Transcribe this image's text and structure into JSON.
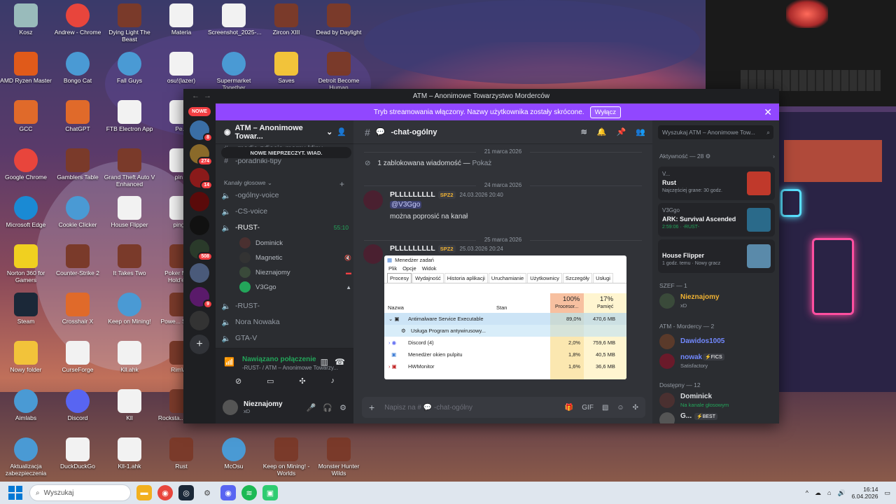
{
  "colors": {
    "accent": "#5865f2",
    "stream": "#9147ff",
    "online": "#23a55a",
    "danger": "#f23f43"
  },
  "desktop": {
    "icons": [
      {
        "label": "Kosz",
        "icon": "recycle-bin-icon"
      },
      {
        "label": "Andrew - Chrome",
        "icon": "chrome-icon"
      },
      {
        "label": "Dying Light The Beast",
        "icon": "game-icon"
      },
      {
        "label": "Materia",
        "icon": "file-icon"
      },
      {
        "label": "Screenshot_2025-...",
        "icon": "file-icon"
      },
      {
        "label": "Zircon XIII",
        "icon": "game-icon"
      },
      {
        "label": "Dead by Daylight",
        "icon": "game-icon"
      },
      {
        "label": "AMD Ryzen Master",
        "icon": "amd-icon"
      },
      {
        "label": "Bongo Cat",
        "icon": "web-icon"
      },
      {
        "label": "Fall Guys",
        "icon": "web-icon"
      },
      {
        "label": "osu!(lazer)",
        "icon": "file-icon"
      },
      {
        "label": "Supermarket Together",
        "icon": "web-icon"
      },
      {
        "label": "Saves",
        "icon": "folder-icon"
      },
      {
        "label": "Detroit Become Human",
        "icon": "game-icon"
      },
      {
        "label": "GCC",
        "icon": "app-icon"
      },
      {
        "label": "ChatGPT",
        "icon": "app-icon"
      },
      {
        "label": "FTB Electron App",
        "icon": "file-icon"
      },
      {
        "label": "Pe...",
        "icon": "file-icon"
      },
      {
        "label": "Google Chrome",
        "icon": "chrome-icon"
      },
      {
        "label": "Gamblers Table",
        "icon": "game-icon"
      },
      {
        "label": "Grand Theft Auto V Enhanced",
        "icon": "game-icon"
      },
      {
        "label": "pin...",
        "icon": "file-icon"
      },
      {
        "label": "Microsoft Edge",
        "icon": "edge-icon"
      },
      {
        "label": "Cookie Clicker",
        "icon": "web-icon"
      },
      {
        "label": "House Flipper",
        "icon": "file-icon"
      },
      {
        "label": "ping...",
        "icon": "file-icon"
      },
      {
        "label": "Norton 360 for Gamers",
        "icon": "norton-icon"
      },
      {
        "label": "Counter-Strike 2",
        "icon": "game-icon"
      },
      {
        "label": "It Takes Two",
        "icon": "game-icon"
      },
      {
        "label": "Poker Mas... Hold'em...",
        "icon": "game-icon"
      },
      {
        "label": "Steam",
        "icon": "steam-icon"
      },
      {
        "label": "Crosshair X",
        "icon": "app-icon"
      },
      {
        "label": "Keep on Mining!",
        "icon": "web-icon"
      },
      {
        "label": "Powe... Simul...",
        "icon": "game-icon"
      },
      {
        "label": "Nowy folder",
        "icon": "folder-icon"
      },
      {
        "label": "CurseForge",
        "icon": "file-icon"
      },
      {
        "label": "Kll.ahk",
        "icon": "file-icon"
      },
      {
        "label": "RimW...",
        "icon": "game-icon"
      },
      {
        "label": "Aimlabs",
        "icon": "web-icon"
      },
      {
        "label": "Discord",
        "icon": "discord-icon"
      },
      {
        "label": "Kll",
        "icon": "file-icon"
      },
      {
        "label": "Rocksta... Laun...",
        "icon": "game-icon"
      },
      {
        "label": "Aktualizacja zabezpieczenia",
        "icon": "web-icon"
      },
      {
        "label": "DuckDuckGo",
        "icon": "file-icon"
      },
      {
        "label": "Kll-1.ahk",
        "icon": "file-icon"
      },
      {
        "label": "Rust",
        "icon": "game-icon"
      },
      {
        "label": "McOsu",
        "icon": "web-icon"
      },
      {
        "label": "Keep on Mining! - Worlds",
        "icon": "game-icon"
      },
      {
        "label": "Monster Hunter Wilds",
        "icon": "game-icon"
      }
    ]
  },
  "taskbar": {
    "search_placeholder": "Wyszukaj",
    "time": "16:14",
    "date": "6.04.2026"
  },
  "discord": {
    "window_title": "ATM – Anonimowe Towarzystwo Morderców",
    "banner": {
      "text": "Tryb streamowania włączony. Nazwy użytkownika zostały skrócone.",
      "button": "Wyłącz"
    },
    "rail": {
      "nowe": "NOWE",
      "badges": [
        "8",
        "274",
        "14",
        "",
        "508",
        "9"
      ]
    },
    "server_name": "ATM – Anonimowe Towar...",
    "unread_pill": "NOWE NIEPRZECZYT. WIAD.",
    "channels": [
      {
        "name": "-media-zdjecia-memy-klipy"
      },
      {
        "name": "-poradniki-tipy"
      }
    ],
    "voice_category": "Kanały głosowe",
    "voice_channels": {
      "ogolny": "-ogólny-voice",
      "cs": "-CS-voice",
      "rust": "-RUST-",
      "rust_time": "55:10",
      "rust2": "-RUST-",
      "nora": "Nora Nowaka",
      "gta": "GTA-V"
    },
    "voice_users": [
      "Dominick",
      "Magnetic",
      "Nieznajomy",
      "V3Ggo"
    ],
    "connection": {
      "status": "Nawiązano połączenie",
      "detail": "-RUST- / ATM – Anonimowe Towarzy..."
    },
    "me": {
      "name": "Nieznajomy",
      "sub": "xD"
    },
    "chat": {
      "channel": "-chat-ogólny",
      "dividers": [
        "21 marca 2026",
        "24 marca 2026",
        "25 marca 2026"
      ],
      "blocked": "1 zablokowana wiadomość —",
      "blocked_link": "Pokaż",
      "msg1": {
        "author": "PLLLLLLLLL",
        "tag": "SPZ2",
        "time": "24.03.2026 20:40",
        "mention": "@V3Ggo",
        "text": "można poprosić na kanał"
      },
      "msg2": {
        "author": "PLLLLLLLLL",
        "tag": "SPZ2",
        "time": "25.03.2026 20:24"
      },
      "input_placeholder": "Napisz na # 💬 -chat-ogólny"
    },
    "taskmgr": {
      "title": "Menedżer zadań",
      "menu": [
        "Plik",
        "Opcje",
        "Widok"
      ],
      "tabs": [
        "Procesy",
        "Wydajność",
        "Historia aplikacji",
        "Uruchamianie",
        "Użytkownicy",
        "Szczegóły",
        "Usługi"
      ],
      "col_name": "Nazwa",
      "col_status": "Stan",
      "cpu_pct": "100%",
      "cpu_label": "Procesor...",
      "mem_pct": "17%",
      "mem_label": "Pamięć",
      "rows": [
        {
          "name": "Antimalware Service Executable",
          "cpu": "89,0%",
          "mem": "470,6 MB"
        },
        {
          "name": "Usługa Program antywirusowy...",
          "cpu": "",
          "mem": ""
        },
        {
          "name": "Discord (4)",
          "cpu": "2,0%",
          "mem": "759,6 MB"
        },
        {
          "name": "Menedżer okien pulpitu",
          "cpu": "1,8%",
          "mem": "40,5 MB"
        },
        {
          "name": "HWMonitor",
          "cpu": "1,6%",
          "mem": "36,6 MB"
        }
      ]
    },
    "right": {
      "search": "Wyszukaj ATM – Anonimowe Tow...",
      "activity_header": "Aktywność — 28",
      "activities": [
        {
          "user": "V...",
          "game": "Rust",
          "sub": "Najczęściej grane: 30 godz."
        },
        {
          "user": "V3Ggo",
          "game": "ARK: Survival Ascended",
          "sub": "2:59:06 · -RUST-"
        },
        {
          "user": "",
          "game": "House Flipper",
          "sub": "1 godz. temu · Nowy gracz"
        }
      ],
      "szef_header": "SZEF — 1",
      "szef_member": {
        "name": "Nieznajomy",
        "sub": "xD"
      },
      "morder_header": "ATM - Mordercy — 2",
      "morder": [
        {
          "name": "Dawidos1005",
          "sub": ""
        },
        {
          "name": "nowak",
          "tag": "FICS",
          "sub": "Satisfactory"
        }
      ],
      "dostepny_header": "Dostępny — 12",
      "dostepny": [
        {
          "name": "Dominick",
          "sub": "Na kanale głosowym"
        },
        {
          "name": "G...",
          "tag": "BEST"
        }
      ]
    }
  }
}
